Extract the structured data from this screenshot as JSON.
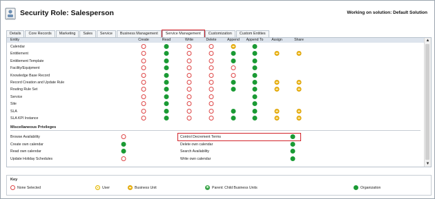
{
  "header": {
    "title": "Security Role: Salesperson",
    "solution": "Working on solution: Default Solution"
  },
  "tabs": [
    "Details",
    "Core Records",
    "Marketing",
    "Sales",
    "Service",
    "Business Management",
    "Service Management",
    "Customization",
    "Custom Entities"
  ],
  "active_tab": "Service Management",
  "columns": [
    "Entity",
    "Create",
    "Read",
    "Write",
    "Delete",
    "Append",
    "Append To",
    "Assign",
    "Share"
  ],
  "entities": [
    {
      "name": "Calendar",
      "levels": [
        "none",
        "org",
        "none",
        "none",
        "bu",
        "org",
        "",
        ""
      ]
    },
    {
      "name": "Entitlement",
      "levels": [
        "none",
        "org",
        "none",
        "none",
        "org",
        "org",
        "bu",
        "bu"
      ]
    },
    {
      "name": "Entitlement Template",
      "levels": [
        "none",
        "org",
        "none",
        "none",
        "org",
        "org",
        "",
        ""
      ]
    },
    {
      "name": "Facility/Equipment",
      "levels": [
        "none",
        "org",
        "none",
        "none",
        "none",
        "org",
        "",
        ""
      ]
    },
    {
      "name": "Knowledge Base Record",
      "levels": [
        "none",
        "org",
        "none",
        "none",
        "none",
        "org",
        "",
        ""
      ]
    },
    {
      "name": "Record Creation and Update Rule",
      "levels": [
        "none",
        "org",
        "none",
        "none",
        "org",
        "org",
        "bu",
        "bu"
      ]
    },
    {
      "name": "Routing Rule Set",
      "levels": [
        "none",
        "org",
        "none",
        "none",
        "org",
        "org",
        "bu",
        "bu"
      ]
    },
    {
      "name": "Service",
      "levels": [
        "none",
        "org",
        "none",
        "none",
        "",
        "org",
        "",
        ""
      ]
    },
    {
      "name": "Site",
      "levels": [
        "none",
        "org",
        "none",
        "none",
        "",
        "org",
        "",
        ""
      ]
    },
    {
      "name": "SLA",
      "levels": [
        "none",
        "org",
        "none",
        "none",
        "org",
        "org",
        "bu",
        "bu"
      ]
    },
    {
      "name": "SLA KPI Instance",
      "levels": [
        "none",
        "org",
        "none",
        "none",
        "org",
        "org",
        "bu",
        "bu"
      ]
    }
  ],
  "misc": {
    "title": "Miscellaneous Privileges",
    "left": [
      {
        "name": "Browse Availability",
        "level": "none"
      },
      {
        "name": "Create own calendar",
        "level": "org"
      },
      {
        "name": "Read own calendar",
        "level": "org"
      },
      {
        "name": "Update Holiday Schedules",
        "level": "none"
      }
    ],
    "right": [
      {
        "name": "Control Decrement Terms",
        "level": "org"
      },
      {
        "name": "Delete own calendar",
        "level": "org"
      },
      {
        "name": "Search Availability",
        "level": "org"
      },
      {
        "name": "Write own calendar",
        "level": "org"
      }
    ]
  },
  "key": {
    "title": "Key",
    "items": [
      {
        "level": "none",
        "label": "None Selected"
      },
      {
        "level": "user",
        "label": "User"
      },
      {
        "level": "bu",
        "label": "Business Unit"
      },
      {
        "level": "parent",
        "label": "Parent: Child Business Units"
      },
      {
        "level": "org",
        "label": "Organization"
      }
    ]
  },
  "icons": {
    "role": "security-role-icon",
    "scroll_up": "scroll-up-arrow-icon",
    "scroll_down": "scroll-down-arrow-icon"
  },
  "colors": {
    "highlight": "#d2232a",
    "organization": "#1a9a34",
    "business_unit": "#f2c12e",
    "none": "#d44444",
    "header_band": "#dde4ed"
  }
}
